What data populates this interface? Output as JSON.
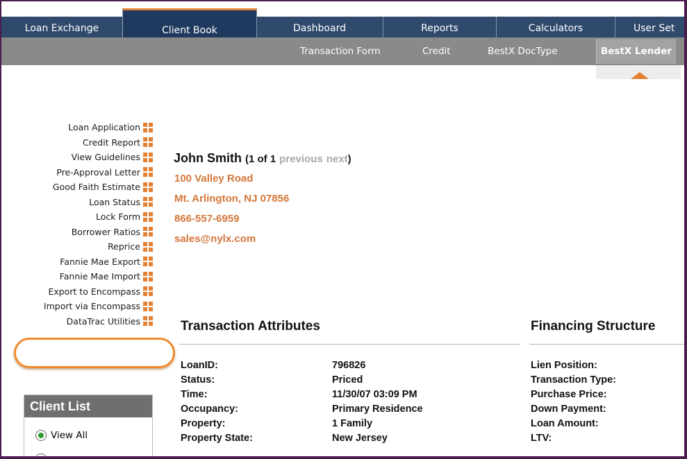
{
  "nav": {
    "tabs": [
      {
        "label": "Loan Exchange"
      },
      {
        "label": "Client Book"
      },
      {
        "label": "Dashboard"
      },
      {
        "label": "Reports"
      },
      {
        "label": "Calculators"
      },
      {
        "label": "User Set"
      }
    ],
    "subtabs": [
      {
        "label": "Transaction Form"
      },
      {
        "label": "Credit"
      },
      {
        "label": "BestX DocType"
      },
      {
        "label": "BestX Lender"
      }
    ]
  },
  "menu": {
    "items": [
      "Loan Application",
      "Credit Report",
      "View Guidelines",
      "Pre-Approval Letter",
      "Good Faith Estimate",
      "Loan Status",
      "Lock Form",
      "Borrower Ratios",
      "Reprice",
      "Fannie Mae Export",
      "Fannie Mae Import",
      "Export to Encompass",
      "Import via Encompass",
      "DataTrac Utilities"
    ]
  },
  "client_list": {
    "title": "Client List",
    "option_view_all": "View All"
  },
  "client": {
    "name": "John Smith",
    "count_open": "(1 of 1",
    "previous": "previous",
    "next": "next",
    "count_close": ")",
    "address1": "100 Valley Road",
    "address2": "Mt. Arlington, NJ 07856",
    "phone": "866-557-6959",
    "email": "sales@nylx.com"
  },
  "transaction": {
    "title": "Transaction Attributes",
    "rows": [
      {
        "label": "LoanID:",
        "value": "796826"
      },
      {
        "label": "Status:",
        "value": "Priced"
      },
      {
        "label": "Time:",
        "value": "11/30/07 03:09 PM"
      },
      {
        "label": "Occupancy:",
        "value": "Primary Residence"
      },
      {
        "label": "Property:",
        "value": "1 Family"
      },
      {
        "label": "Property State:",
        "value": "New Jersey"
      }
    ]
  },
  "financing": {
    "title": "Financing Structure",
    "rows": [
      "Lien Position:",
      "Transaction Type:",
      "Purchase Price:",
      "Down Payment:",
      "Loan Amount:",
      "LTV:"
    ]
  },
  "colors": {
    "accent": "#e38033",
    "nav": "#2f4a6d",
    "link": "#d4773a",
    "border": "#4b1c4e"
  }
}
